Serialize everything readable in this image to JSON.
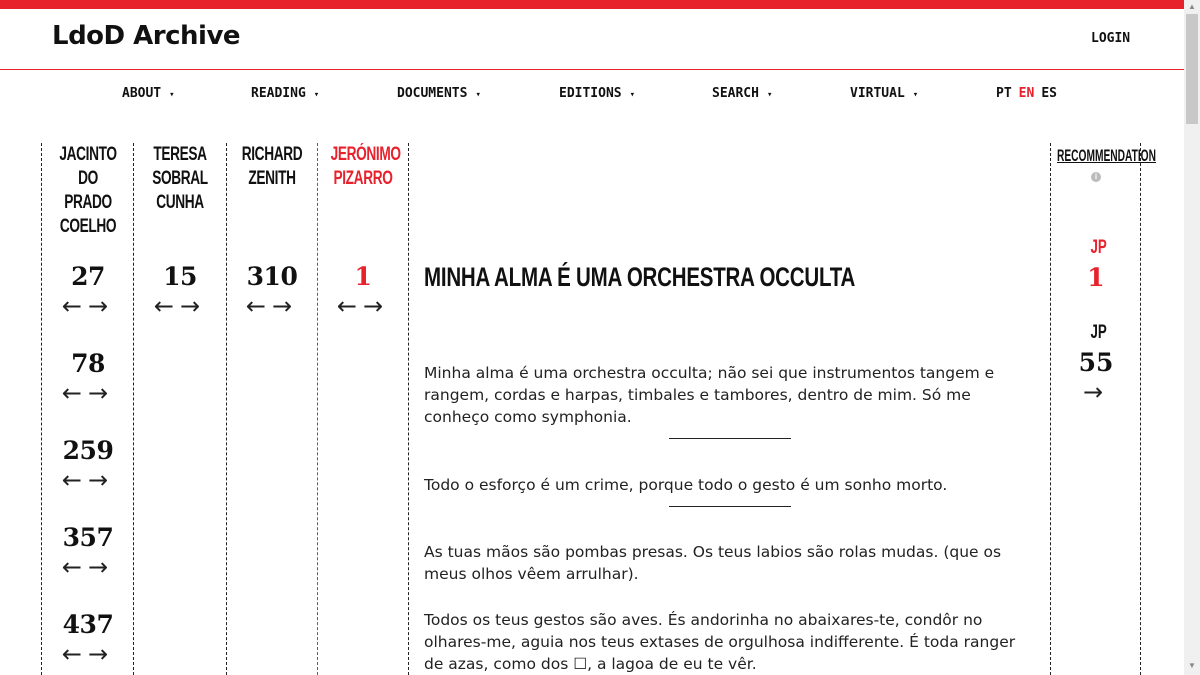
{
  "header": {
    "logo": "LdoD Archive",
    "login": "LOGIN"
  },
  "nav": {
    "items": [
      "ABOUT",
      "READING",
      "DOCUMENTS",
      "EDITIONS",
      "SEARCH",
      "VIRTUAL"
    ],
    "caret": "▾",
    "langs": [
      "PT",
      "EN",
      "ES"
    ],
    "active_lang": "EN"
  },
  "columns": [
    {
      "name": "JACINTO DO PRADO COELHO",
      "lines": [
        "JACINTO DO",
        "PRADO",
        "COELHO"
      ],
      "numbers": [
        "27",
        "78",
        "259",
        "357",
        "437"
      ]
    },
    {
      "name": "TERESA SOBRAL CUNHA",
      "lines": [
        "TERESA",
        "SOBRAL",
        "CUNHA"
      ],
      "numbers": [
        "15"
      ]
    },
    {
      "name": "RICHARD ZENITH",
      "lines": [
        "RICHARD",
        "ZENITH"
      ],
      "numbers": [
        "310"
      ]
    },
    {
      "name": "JERÓNIMO PIZARRO",
      "lines": [
        "JERÓNIMO",
        "PIZARRO"
      ],
      "numbers": [
        "1"
      ]
    }
  ],
  "arrows": {
    "left": "←",
    "right": "→"
  },
  "main": {
    "title": "MINHA ALMA É UMA ORCHESTRA OCCULTA",
    "paragraphs": [
      "Minha alma é uma orchestra occulta; não sei que instrumentos tangem e rangem, cordas e harpas, timbales e tambores, dentro de mim. Só me conheço como symphonia.",
      "Todo o esforço é um crime, porque todo o gesto é um sonho morto.",
      "As tuas mãos são pombas presas. Os teus labios são rolas mudas. (que os meus olhos vêem arrulhar).",
      "Todos os teus gestos são aves. És andorinha no abaixares-te, condôr no olhares-me, aguia nos teus extases de orgulhosa indifferente. É toda ranger de azas, como dos ☐, a lagoa de eu te vêr."
    ]
  },
  "recommendation": {
    "title": "RECOMMENDATION",
    "info": "i",
    "items": [
      {
        "label": "JP",
        "number": "1"
      },
      {
        "label": "JP",
        "number": "55"
      }
    ],
    "next": "→"
  },
  "colors": {
    "accent": "#e8222d",
    "text": "#111111"
  }
}
